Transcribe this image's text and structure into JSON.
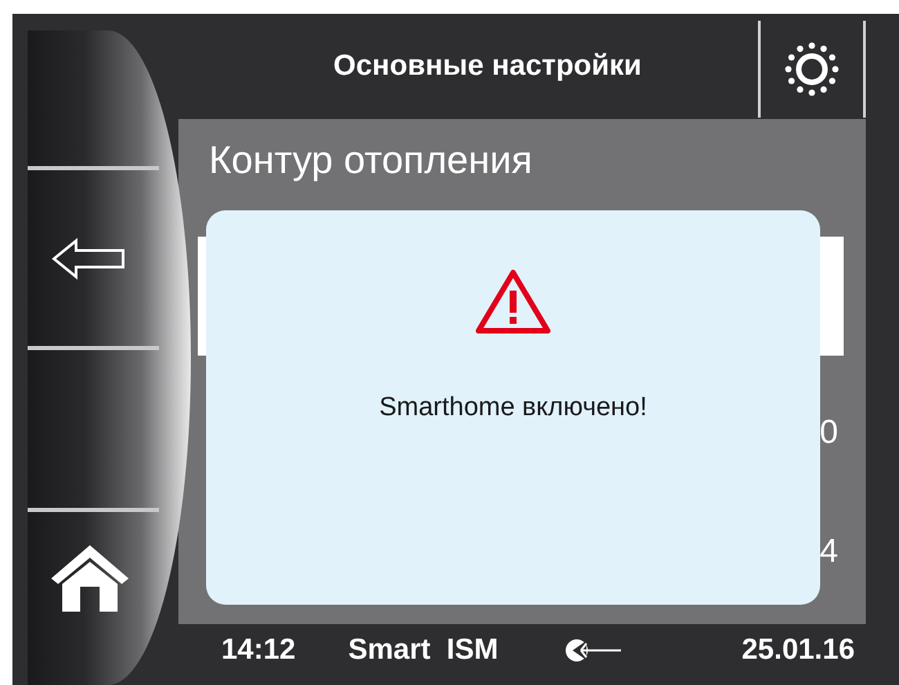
{
  "header": {
    "title": "Основные настройки"
  },
  "sidebar": {
    "buttons": [
      {
        "kind": "back"
      },
      {
        "kind": "home"
      }
    ]
  },
  "panel": {
    "title": "Контур отопления",
    "values": [
      "0",
      "4"
    ]
  },
  "dialog": {
    "message": "Smarthome включено!"
  },
  "status_bar": {
    "time": "14:12",
    "mode": "Smart  ISM",
    "date": "25.01.16"
  }
}
